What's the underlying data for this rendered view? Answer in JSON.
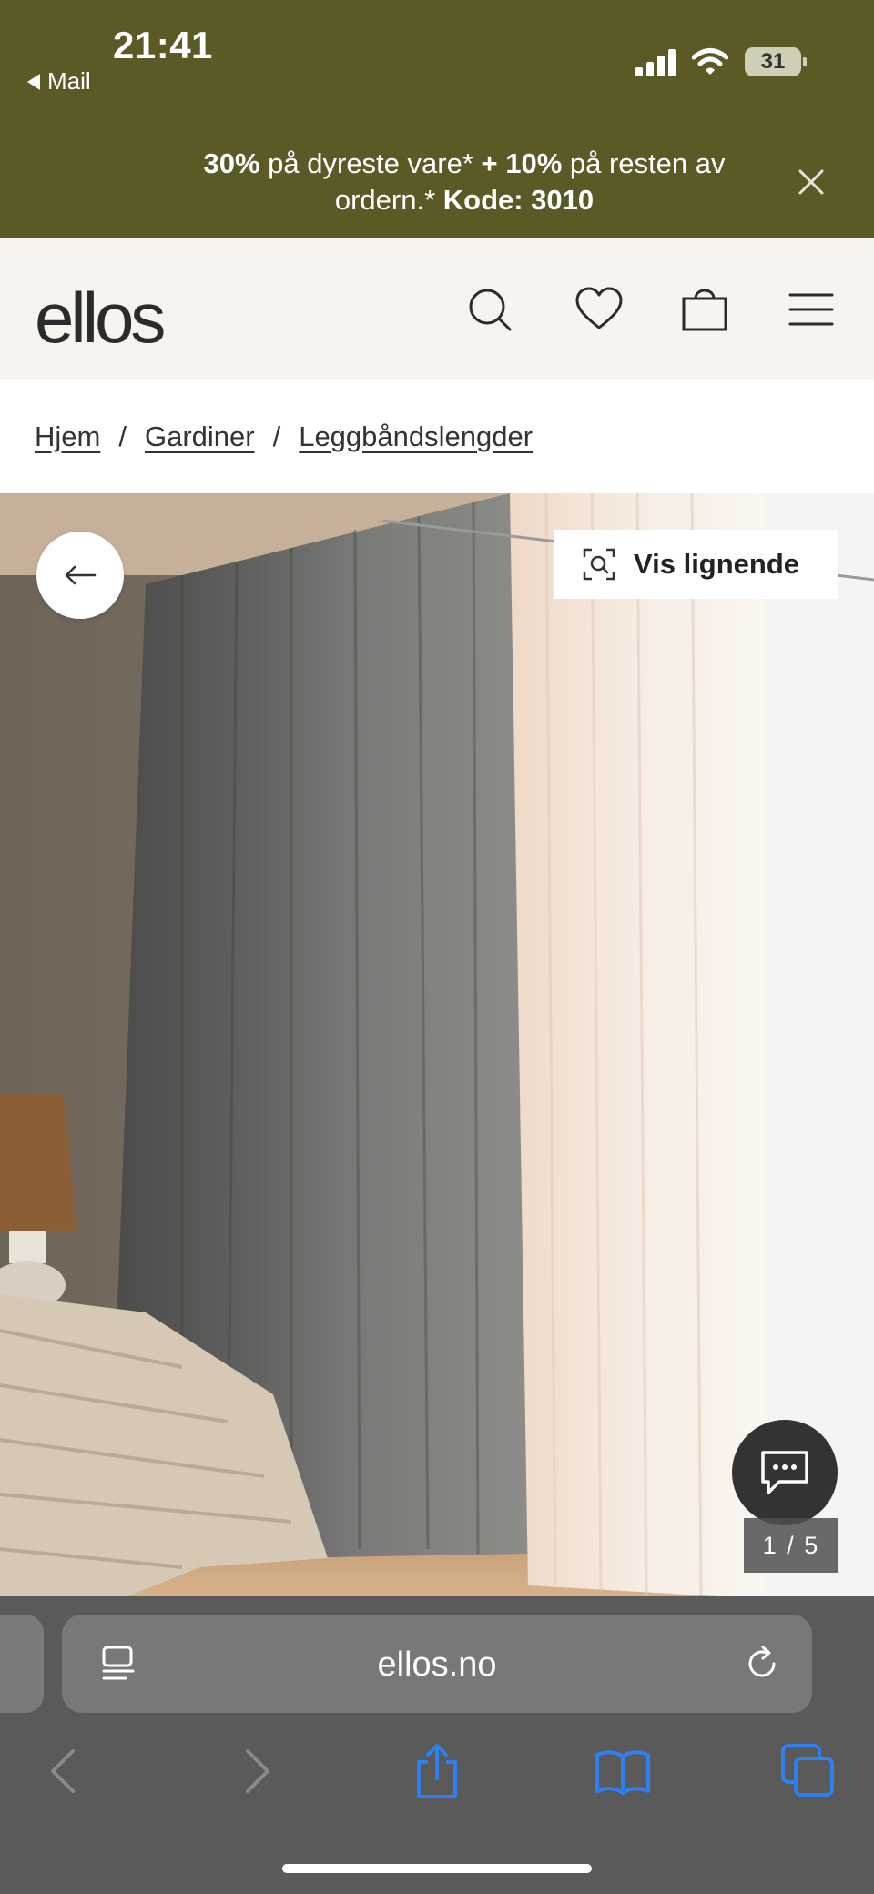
{
  "status_bar": {
    "time": "21:41",
    "back_label": "Mail",
    "battery": "31"
  },
  "promo": {
    "part1_bold": "30%",
    "part2": " på dyreste vare* ",
    "part3_bold": "+ 10%",
    "part4": " på resten av ordern.* ",
    "part5_bold": "Kode: 3010"
  },
  "header": {
    "logo": "ellos",
    "icons": [
      "search-icon",
      "heart-icon",
      "bag-icon",
      "menu-icon"
    ]
  },
  "breadcrumb": {
    "items": [
      "Hjem",
      "Gardiner",
      "Leggbåndslengder"
    ],
    "separator": "/"
  },
  "product": {
    "similar_button": "Vis lignende",
    "image_counter": "1 / 5"
  },
  "browser": {
    "url": "ellos.no"
  },
  "colors": {
    "promo_bg": "#5b5a27",
    "header_bg": "#f7f4ef",
    "browser_bg": "#5a5a5a",
    "safari_blue": "#2f7ff0"
  }
}
